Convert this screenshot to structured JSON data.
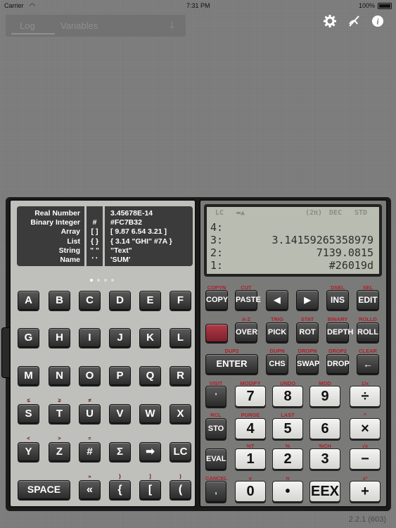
{
  "status_bar": {
    "carrier": "Carrier",
    "time": "7:31 PM",
    "battery": "100%"
  },
  "tabs": {
    "log": "Log",
    "variables": "Variables",
    "down_arrow": "↓"
  },
  "top_icons": [
    "gear-icon",
    "alpha-off-icon",
    "info-icon"
  ],
  "help": {
    "labels": [
      "Real Number",
      "Binary Integer",
      "Array",
      "List",
      "String",
      "Name"
    ],
    "symbols": [
      "",
      "#",
      "[ ]",
      "{ }",
      "\" \"",
      "' '"
    ],
    "examples": [
      "3.45678E-14",
      "#FC7B32",
      "[ 9.87  6.54  3.21 ]",
      "{ 3.14  \"GHI\"  #7A }",
      "\"Text\"",
      "'SUM'"
    ]
  },
  "lcd": {
    "annunciators": [
      "LC",
      "(2π)",
      "DEC",
      "STD"
    ],
    "stack": [
      {
        "level": "4:",
        "value": ""
      },
      {
        "level": "3:",
        "value": "3.14159265358979"
      },
      {
        "level": "2:",
        "value": "7139.0815"
      },
      {
        "level": "1:",
        "value": "#26019d"
      }
    ]
  },
  "left_keys": {
    "row1": [
      "A",
      "B",
      "C",
      "D",
      "E",
      "F"
    ],
    "row2": [
      "G",
      "H",
      "I",
      "J",
      "K",
      "L"
    ],
    "row3": [
      "M",
      "N",
      "O",
      "P",
      "Q",
      "R"
    ],
    "row4": [
      "S",
      "T",
      "U",
      "V",
      "W",
      "X"
    ],
    "row4_shift": [
      "≤",
      "≥",
      "≠"
    ],
    "row5": [
      "Y",
      "Z",
      "#",
      "Σ",
      "➡",
      "LC"
    ],
    "row5_shift": [
      "<",
      ">",
      "="
    ],
    "row6": [
      "SPACE",
      "«",
      "{",
      "[",
      "("
    ],
    "row6_shift": [
      "»",
      "}",
      "]",
      ")"
    ]
  },
  "right_keys": {
    "row1": [
      "COPY",
      "PASTE",
      "◀",
      "▶",
      "INS",
      "EDIT"
    ],
    "row1_shift": [
      "COPYN",
      "CUT",
      "DSEL",
      "SEL"
    ],
    "row2": [
      "OVER",
      "PICK",
      "ROT",
      "DEPTH",
      "ROLL"
    ],
    "row2_shift": [
      "A-Z",
      "TRIG",
      "STAT",
      "BINARY",
      "ROLLD"
    ],
    "row3": [
      "ENTER",
      "CHS",
      "SWAP",
      "DROP",
      "←"
    ],
    "row3_shift": [
      "DUP2",
      "DUPN",
      "DROPN",
      "DROP2",
      "CLEAR"
    ],
    "row4": [
      "'",
      "7",
      "8",
      "9",
      "÷"
    ],
    "row4_shift": [
      "VISIT",
      "MODIFY",
      "UNDO",
      "MOD",
      "1/x"
    ],
    "row5": [
      "STO",
      "4",
      "5",
      "6",
      "×"
    ],
    "row5_shift": [
      "RCL",
      "PURGE",
      "LAST",
      "^"
    ],
    "row6": [
      "EVAL",
      "1",
      "2",
      "3",
      "−"
    ],
    "row6_shift": [
      "%T",
      "%",
      "%CH",
      "√x"
    ],
    "row7": [
      ",",
      "0",
      "•",
      "EEX",
      "+"
    ],
    "row7_shift": [
      "CANCEL",
      "e",
      "π",
      "x²"
    ]
  },
  "version": "2.2.1 (603)",
  "colors": {
    "shift_label": "#b0202a",
    "shift_key": "#9b2b37",
    "lcd": "#b9bcb0"
  }
}
